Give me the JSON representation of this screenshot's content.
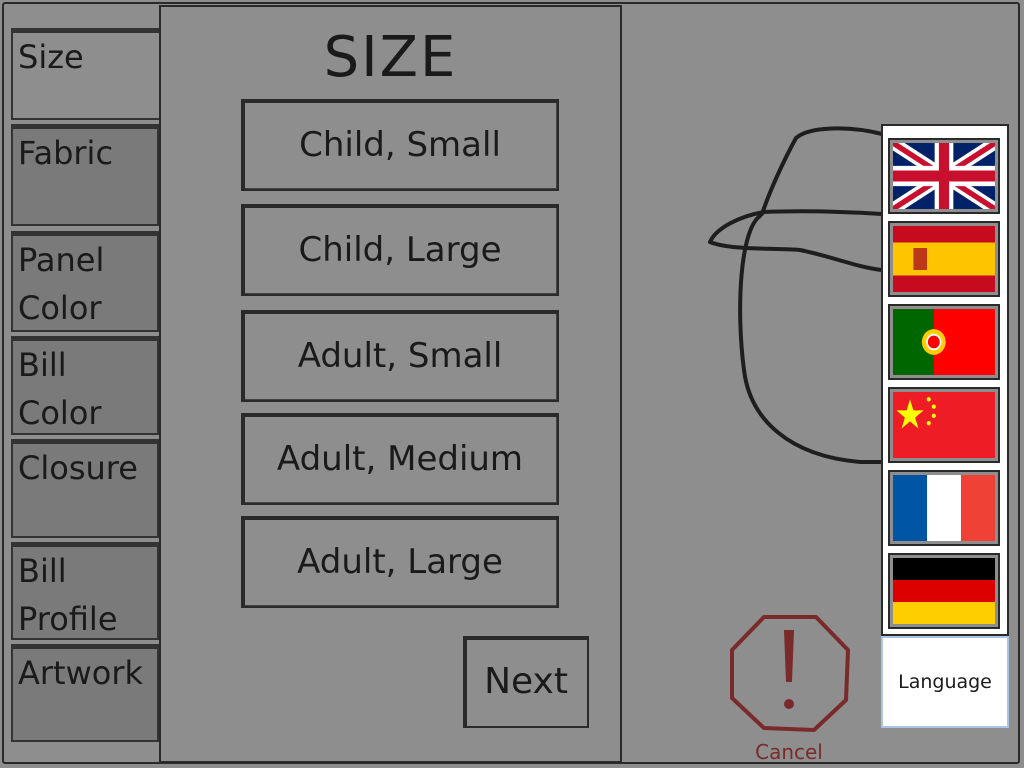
{
  "tabs": [
    {
      "key": "size",
      "label": "Size",
      "active": true
    },
    {
      "key": "fabric",
      "label": "Fabric",
      "active": false
    },
    {
      "key": "panel-color",
      "label": "Panel\nColor",
      "active": false
    },
    {
      "key": "bill-color",
      "label": "Bill\nColor",
      "active": false
    },
    {
      "key": "closure",
      "label": "Closure",
      "active": false
    },
    {
      "key": "bill-profile",
      "label": "Bill\nProfile",
      "active": false
    },
    {
      "key": "artwork",
      "label": "Artwork",
      "active": false
    }
  ],
  "panel": {
    "title": "SIZE",
    "options": [
      "Child, Small",
      "Child, Large",
      "Adult, Small",
      "Adult, Medium",
      "Adult, Large"
    ],
    "next_label": "Next"
  },
  "cancel": {
    "label": "Cancel",
    "icon": "warning-octagon-icon",
    "color": "#7a2a2a"
  },
  "language": {
    "label": "Language",
    "flags": [
      "uk-flag-icon",
      "spain-flag-icon",
      "portugal-flag-icon",
      "china-flag-icon",
      "france-flag-icon",
      "germany-flag-icon"
    ]
  },
  "colors": {
    "background": "#8e8e8e",
    "tab_inactive": "#7a7a7a",
    "border": "#2a2a2a",
    "language_border": "#a8c4e6"
  }
}
